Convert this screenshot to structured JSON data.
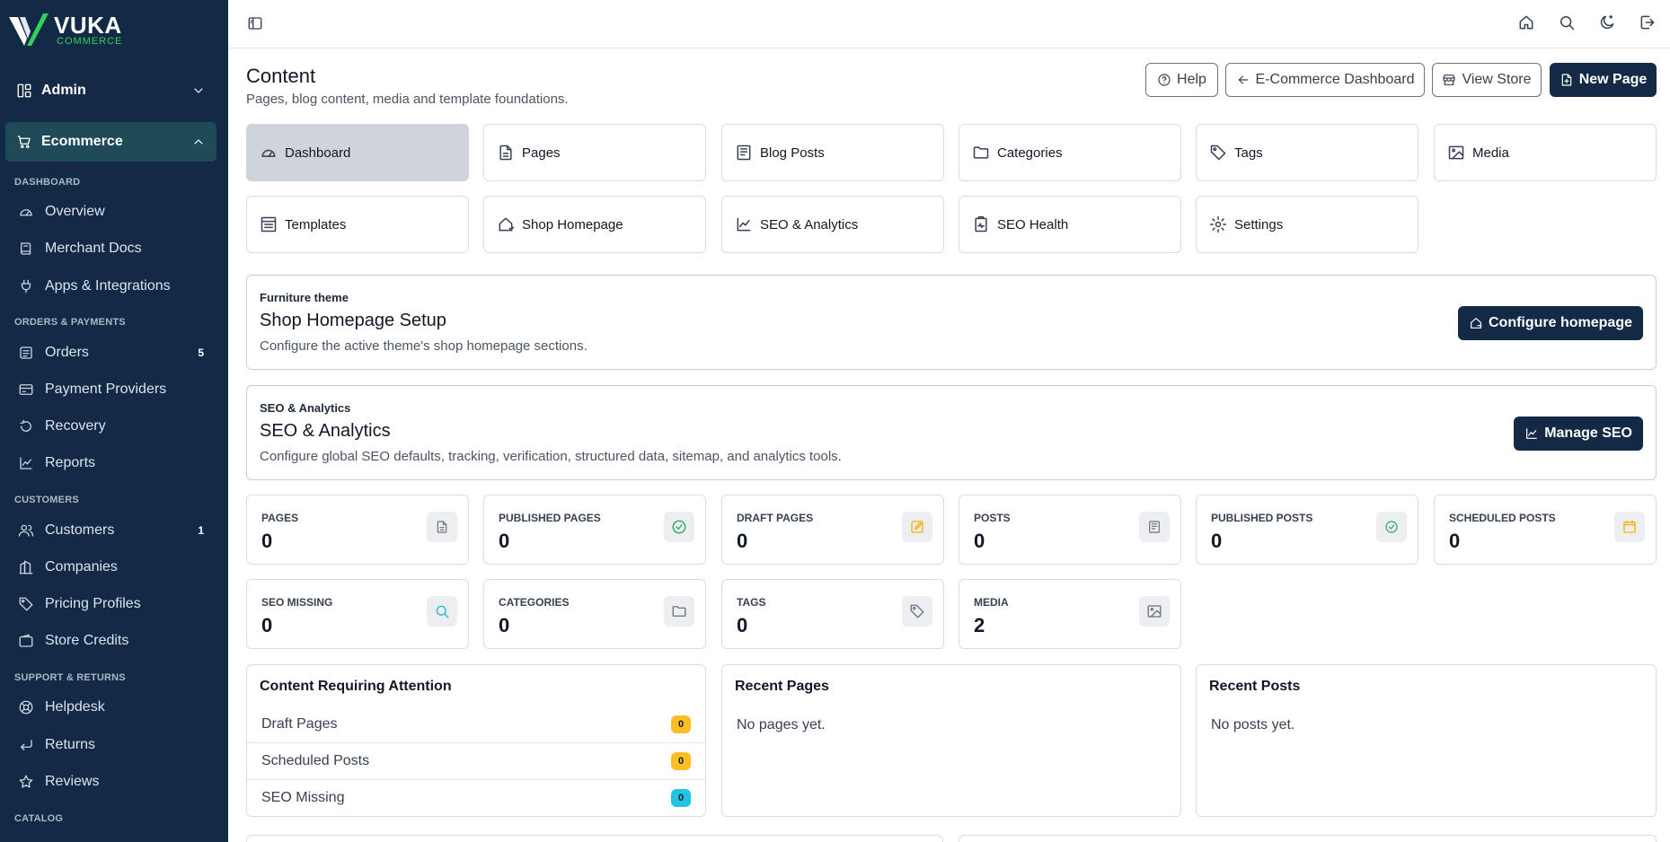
{
  "colors": {
    "sidebar_bg": "#122a45",
    "accent_green": "#34d058",
    "primary_button": "#122a45",
    "badge_warning": "#fbbf24",
    "badge_info": "#22c3e6"
  },
  "brand": {
    "name": "VUKA",
    "tagline": "COMMERCE"
  },
  "sidebar": {
    "admin": {
      "label": "Admin",
      "icon": "layout-icon"
    },
    "ecommerce": {
      "label": "Ecommerce",
      "icon": "cart-icon"
    },
    "sections": [
      {
        "label": "DASHBOARD",
        "items": [
          {
            "label": "Overview",
            "icon": "gauge-icon"
          },
          {
            "label": "Merchant Docs",
            "icon": "book-icon"
          },
          {
            "label": "Apps & Integrations",
            "icon": "plug-icon"
          }
        ]
      },
      {
        "label": "ORDERS & PAYMENTS",
        "items": [
          {
            "label": "Orders",
            "icon": "list-icon",
            "badge": "5"
          },
          {
            "label": "Payment Providers",
            "icon": "card-icon"
          },
          {
            "label": "Recovery",
            "icon": "refresh-icon"
          },
          {
            "label": "Reports",
            "icon": "chart-icon"
          }
        ]
      },
      {
        "label": "CUSTOMERS",
        "items": [
          {
            "label": "Customers",
            "icon": "users-icon",
            "badge": "1"
          },
          {
            "label": "Companies",
            "icon": "building-icon"
          },
          {
            "label": "Pricing Profiles",
            "icon": "tag-icon"
          },
          {
            "label": "Store Credits",
            "icon": "wallet-icon"
          }
        ]
      },
      {
        "label": "SUPPORT & RETURNS",
        "items": [
          {
            "label": "Helpdesk",
            "icon": "lifebuoy-icon"
          },
          {
            "label": "Returns",
            "icon": "return-icon"
          },
          {
            "label": "Reviews",
            "icon": "star-icon"
          }
        ]
      },
      {
        "label": "CATALOG",
        "items": []
      }
    ]
  },
  "header": {
    "title": "Content",
    "subtitle": "Pages, blog content, media and template foundations.",
    "buttons": {
      "help": "Help",
      "ecom_dashboard": "E-Commerce Dashboard",
      "view_store": "View Store",
      "new_page": "New Page"
    }
  },
  "tiles": [
    {
      "label": "Dashboard",
      "icon": "gauge-icon",
      "active": true
    },
    {
      "label": "Pages",
      "icon": "file-icon"
    },
    {
      "label": "Blog Posts",
      "icon": "blog-icon"
    },
    {
      "label": "Categories",
      "icon": "folder-icon"
    },
    {
      "label": "Tags",
      "icon": "tag-icon"
    },
    {
      "label": "Media",
      "icon": "image-icon"
    },
    {
      "label": "Templates",
      "icon": "template-icon"
    },
    {
      "label": "Shop Homepage",
      "icon": "home-icon"
    },
    {
      "label": "SEO & Analytics",
      "icon": "chart-icon"
    },
    {
      "label": "SEO Health",
      "icon": "clipboard-icon"
    },
    {
      "label": "Settings",
      "icon": "gear-icon"
    }
  ],
  "cards": {
    "homepage": {
      "eyebrow": "Furniture theme",
      "title": "Shop Homepage Setup",
      "desc": "Configure the active theme's shop homepage sections.",
      "button": "Configure homepage"
    },
    "seo": {
      "eyebrow": "SEO & Analytics",
      "title": "SEO & Analytics",
      "desc": "Configure global SEO defaults, tracking, verification, structured data, sitemap, and analytics tools.",
      "button": "Manage SEO"
    }
  },
  "stats": [
    {
      "label": "PAGES",
      "value": "0",
      "icon": "file-icon"
    },
    {
      "label": "PUBLISHED PAGES",
      "value": "0",
      "icon": "check-circle-icon"
    },
    {
      "label": "DRAFT PAGES",
      "value": "0",
      "icon": "edit-icon"
    },
    {
      "label": "POSTS",
      "value": "0",
      "icon": "blog-icon"
    },
    {
      "label": "PUBLISHED POSTS",
      "value": "0",
      "icon": "check-circle-icon"
    },
    {
      "label": "SCHEDULED POSTS",
      "value": "0",
      "icon": "calendar-icon"
    },
    {
      "label": "SEO MISSING",
      "value": "0",
      "icon": "search-icon"
    },
    {
      "label": "CATEGORIES",
      "value": "0",
      "icon": "folder-icon"
    },
    {
      "label": "TAGS",
      "value": "0",
      "icon": "tag-icon"
    },
    {
      "label": "MEDIA",
      "value": "2",
      "icon": "image-icon"
    }
  ],
  "attention": {
    "title": "Content Requiring Attention",
    "rows": [
      {
        "label": "Draft Pages",
        "count": "0"
      },
      {
        "label": "Scheduled Posts",
        "count": "0"
      },
      {
        "label": "SEO Missing",
        "count": "0"
      }
    ]
  },
  "recent_pages": {
    "title": "Recent Pages",
    "empty": "No pages yet."
  },
  "recent_posts": {
    "title": "Recent Posts",
    "empty": "No posts yet."
  }
}
